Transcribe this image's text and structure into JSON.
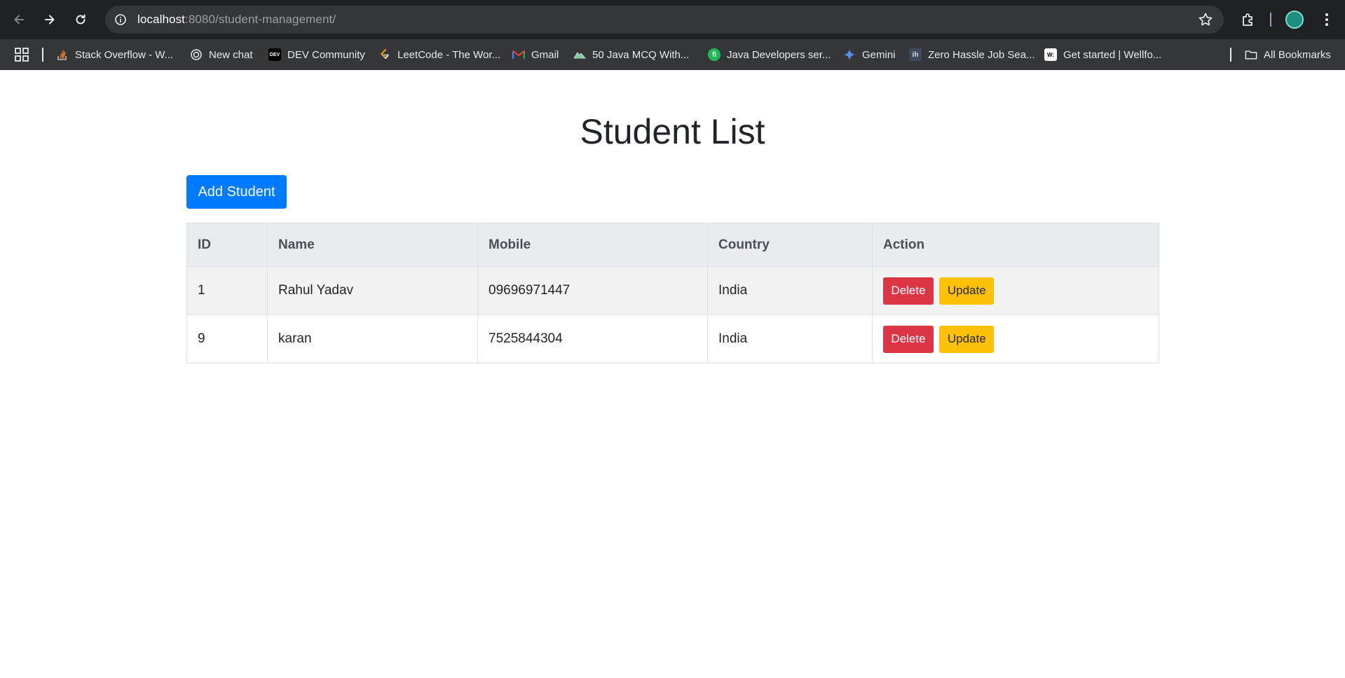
{
  "browser": {
    "url_host": "localhost",
    "url_rest": ":8080/student-management/",
    "bookmarks": [
      {
        "label": "Stack Overflow - W...",
        "icon": "stackoverflow-icon"
      },
      {
        "label": "New chat",
        "icon": "chatgpt-icon"
      },
      {
        "label": "DEV Community",
        "icon": "dev-icon"
      },
      {
        "label": "LeetCode - The Wor...",
        "icon": "leetcode-icon"
      },
      {
        "label": "Gmail",
        "icon": "gmail-icon"
      },
      {
        "label": "50 Java MCQ With...",
        "icon": "mountain-icon"
      },
      {
        "label": "Java Developers ser...",
        "icon": "fi-icon"
      },
      {
        "label": "Gemini",
        "icon": "gemini-icon"
      },
      {
        "label": "Zero Hassle Job Sea...",
        "icon": "ih-icon"
      },
      {
        "label": "Get started | Wellfo...",
        "icon": "wellfound-icon"
      }
    ],
    "all_bookmarks_label": "All Bookmarks",
    "dev_icon_text": "DEV",
    "fi_icon_text": "fi",
    "ih_icon_text": "ih",
    "w_icon_text": "W:"
  },
  "page": {
    "title": "Student List",
    "add_button_label": "Add Student",
    "table": {
      "headers": [
        "ID",
        "Name",
        "Mobile",
        "Country",
        "Action"
      ],
      "rows": [
        {
          "id": "1",
          "name": "Rahul Yadav",
          "mobile": "09696971447",
          "country": "India"
        },
        {
          "id": "9",
          "name": "karan",
          "mobile": "7525844304",
          "country": "India"
        }
      ],
      "delete_label": "Delete",
      "update_label": "Update"
    }
  },
  "colors": {
    "primary": "#007bff",
    "danger": "#dc3545",
    "warning": "#ffc107"
  }
}
